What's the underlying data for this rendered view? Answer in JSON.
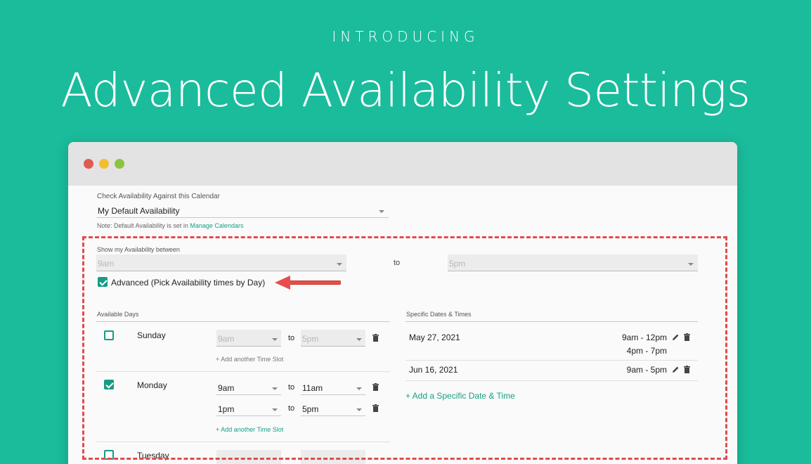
{
  "hero": {
    "eyebrow": "INTRODUCING",
    "title": "Advanced Availability Settings"
  },
  "window_controls": {
    "close": "red",
    "minimize": "yellow",
    "zoom": "green"
  },
  "calendar": {
    "label": "Check Availability Against this Calendar",
    "value": "My Default Availability",
    "note_prefix": "Note: Default Availability is set in ",
    "note_link": "Manage Calendars"
  },
  "availability": {
    "label": "Show my Availability between",
    "from": "9am",
    "to_label": "to",
    "to": "5pm",
    "advanced_checked": true,
    "advanced_label": "Advanced (Pick Availability times by Day)"
  },
  "available_days": {
    "header": "Available Days",
    "days": [
      {
        "name": "Sunday",
        "checked": false,
        "slots": [
          {
            "from": "9am",
            "to_label": "to",
            "to": "5pm"
          }
        ],
        "add_slot": "+ Add another Time Slot"
      },
      {
        "name": "Monday",
        "checked": true,
        "slots": [
          {
            "from": "9am",
            "to_label": "to",
            "to": "11am"
          },
          {
            "from": "1pm",
            "to_label": "to",
            "to": "5pm"
          }
        ],
        "add_slot": "+ Add another Time Slot"
      },
      {
        "name": "Tuesday",
        "checked": false,
        "slots": [],
        "add_slot": ""
      }
    ]
  },
  "specific_dates": {
    "header": "Specific Dates & Times",
    "rows": [
      {
        "date": "May 27, 2021",
        "times": [
          "9am - 12pm",
          "4pm - 7pm"
        ]
      },
      {
        "date": "Jun 16, 2021",
        "times": [
          "9am - 5pm"
        ]
      }
    ],
    "add_link": "+ Add a Specific Date & Time"
  },
  "colors": {
    "background": "#1abc9c",
    "accent": "#179b86",
    "highlight": "#e24b4b"
  }
}
